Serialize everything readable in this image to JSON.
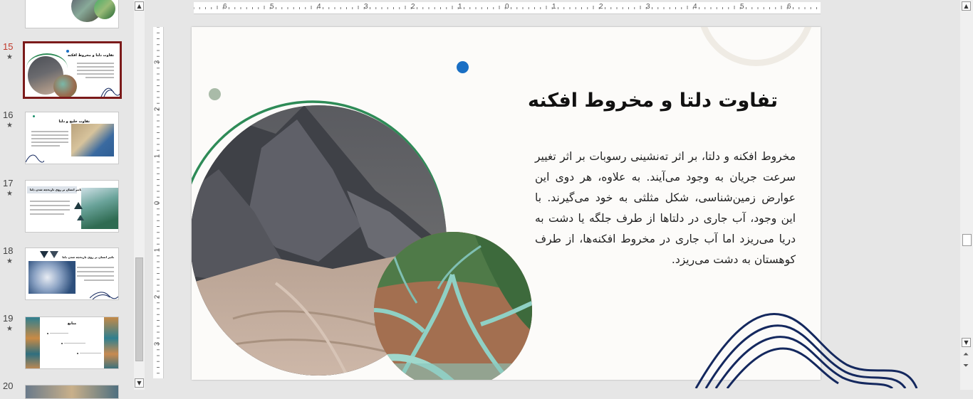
{
  "thumbnails": [
    {
      "number": "15",
      "starred": true,
      "active": true,
      "title": "تفاوت دلتا و مخروط افکنه"
    },
    {
      "number": "16",
      "starred": true,
      "active": false,
      "title": "تفاوت خلیج و دلتا"
    },
    {
      "number": "17",
      "starred": true,
      "active": false,
      "title": "تاثیر انسان بر روی تاریخچه شدن دلتا"
    },
    {
      "number": "18",
      "starred": true,
      "active": false,
      "title": "تاثیر انسان بر روی تاریخچه شدن دلتا"
    },
    {
      "number": "19",
      "starred": true,
      "active": false,
      "title": "منابع"
    },
    {
      "number": "20",
      "starred": false,
      "active": false,
      "title": ""
    }
  ],
  "ruler": {
    "horizontal_labels": [
      "6",
      "5",
      "4",
      "3",
      "2",
      "1",
      "0",
      "1",
      "2",
      "3",
      "4",
      "5",
      "6"
    ],
    "vertical_labels": [
      "3",
      "2",
      "1",
      "0",
      "1",
      "2",
      "3"
    ]
  },
  "slide": {
    "title": "تفاوت دلتا و مخروط افکنه",
    "body": "مخروط افکنه و دلتا، بر اثر ته‌نشینی رسوبات بر اثر تغییر سرعت جریان به وجود می‌آیند. به علاوه، هر دوی این عوارض زمین‌شناسی، شکل مثلثی به خود می‌گیرند. با این وجود، آب جاری در دلتاها از طرف جلگه یا دشت به دریا می‌ریزد اما آب جاری در مخروط افکنه‌ها، از طرف کوهستان به دشت می‌ریزد."
  },
  "colors": {
    "accent_blue": "#1a6fc4",
    "arc_green": "#2e8b57",
    "dot_sage": "#a9bba8",
    "wave_navy": "#14285e",
    "active_border": "#7b1a1a"
  }
}
